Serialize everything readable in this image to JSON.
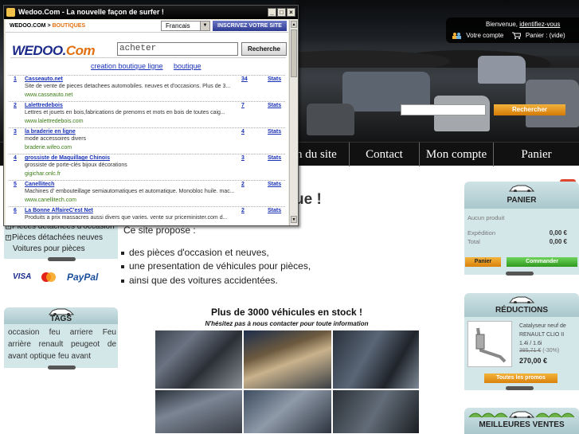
{
  "popup": {
    "title": "Wedoo.Com - La nouvelle façon de surfer !",
    "breadcrumb_root": "WEDOO.COM",
    "breadcrumb_sep": ">",
    "breadcrumb_current": "BOUTIQUES",
    "language": "Francais",
    "signup_label": "INSCRIVEZ VOTRE SITE",
    "logo_main": "WEDOO.",
    "logo_com": "Com",
    "search_value": "acheter",
    "search_button": "Recherche",
    "links": [
      "creation boutique ligne",
      "boutique"
    ],
    "results": [
      {
        "num": "1",
        "name": "Casseauto.net",
        "count": "34",
        "stats": "Stats",
        "desc": "Site de vente de pieces detachees automobiles. neuves et d'occasions. Plus de 3...",
        "url": "www.casseauto.net"
      },
      {
        "num": "2",
        "name": "Lalettredebois",
        "count": "7",
        "stats": "Stats",
        "desc": "Lettres et jouets en bois,fabrications de prenoms et mots en bois de toutes caig...",
        "url": "www.lalettredebois.com"
      },
      {
        "num": "3",
        "name": "la braderie en ligne",
        "count": "4",
        "stats": "Stats",
        "desc": "mode accessoires divers",
        "url": "braderie.wifeo.com"
      },
      {
        "num": "4",
        "name": "grossiste de Maquillage Chinois",
        "count": "3",
        "stats": "Stats",
        "desc": "grossiste de porte-clés bijoux décorations",
        "url": "gigichar.onlc.fr"
      },
      {
        "num": "5",
        "name": "Canellitech",
        "count": "2",
        "stats": "Stats",
        "desc": "Machines d' embouteillage semiautomatiques et automatique. Monobloc huile. mac...",
        "url": "www.canellitech.com"
      },
      {
        "num": "6",
        "name": "La Bonne AffaireC'est Net",
        "count": "2",
        "stats": "Stats",
        "desc": "Produits a prix massacres aussi divers que varies. vente sur priceminister.com d...",
        "url": ""
      }
    ]
  },
  "header": {
    "welcome": "Bienvenue,",
    "login_link": "identifiez-vous",
    "account_label": "Votre compte",
    "cart_label": "Panier : (vide)",
    "search_button": "Rechercher"
  },
  "nav": [
    "n du site",
    "Contact",
    "Mon compte",
    "Panier"
  ],
  "left": {
    "categories": [
      "Pièces détachées d'occasion",
      "Pièces détachées neuves",
      "Voitures pour pièces"
    ],
    "payments": [
      "VISA",
      "MasterCard",
      "PayPal"
    ],
    "tags_title": "TAGS",
    "tags_text": "occasion feu arriere Feu arrière renault peugeot de avant optique feu avant"
  },
  "main": {
    "title_fragment": "ue !",
    "intro": "Ce site propose :",
    "bullets": [
      "des pièces d'occasion et neuves,",
      "une presentation de véhicules pour pièces,",
      "ainsi que des voitures accidentées."
    ],
    "stock_title": "Plus de 3000 véhicules en stock !",
    "stock_sub": "N'hésitez pas à nous contacter pour toute information"
  },
  "cart": {
    "title": "PANIER",
    "empty": "Aucun produit",
    "shipping_label": "Expédition",
    "shipping_value": "0,00 €",
    "total_label": "Total",
    "total_value": "0,00 €",
    "cart_button": "Panier",
    "order_button": "Commander"
  },
  "reductions": {
    "title": "RÉDUCTIONS",
    "product": "Catalyseur neuf de RENAULT CLIO II 1.4i / 1.6i",
    "old_price": "385,71 €",
    "discount": "(-30%)",
    "price": "270,00 €",
    "button": "Toutes les promos"
  },
  "best": {
    "title": "MEILLEURES VENTES"
  },
  "colors": {
    "accent_orange": "#e2700e",
    "link_blue": "#1830b6",
    "block_teal": "#d3e6e8",
    "order_green": "#2f9a1f"
  }
}
